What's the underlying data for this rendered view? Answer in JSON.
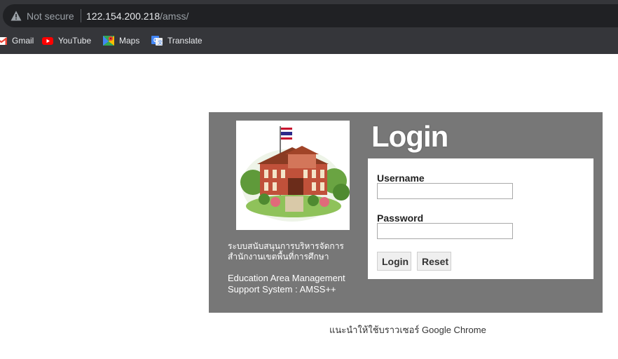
{
  "browser": {
    "security_label": "Not secure",
    "url_host": "122.154.200.218",
    "url_path": "/amss/",
    "bookmarks": [
      {
        "label": "Gmail",
        "icon": "gmail-icon"
      },
      {
        "label": "YouTube",
        "icon": "youtube-icon"
      },
      {
        "label": "Maps",
        "icon": "maps-icon"
      },
      {
        "label": "Translate",
        "icon": "translate-icon"
      }
    ]
  },
  "panel": {
    "thai_line1": "ระบบสนับสนุนการบริหารจัดการ",
    "thai_line2": "สำนักงานเขตพื้นที่การศึกษา",
    "en_line1": "Education Area Management",
    "en_line2": "Support System : AMSS++",
    "login_title": "Login"
  },
  "form": {
    "username_label": "Username",
    "username_value": "",
    "password_label": "Password",
    "password_value": "",
    "login_button": "Login",
    "reset_button": "Reset"
  },
  "footer": {
    "note": "แนะนำให้ใช้บราวเซอร์ Google Chrome"
  },
  "colors": {
    "panel_bg": "#777777",
    "chrome_bg": "#35363a",
    "addressbar_bg": "#202124"
  }
}
